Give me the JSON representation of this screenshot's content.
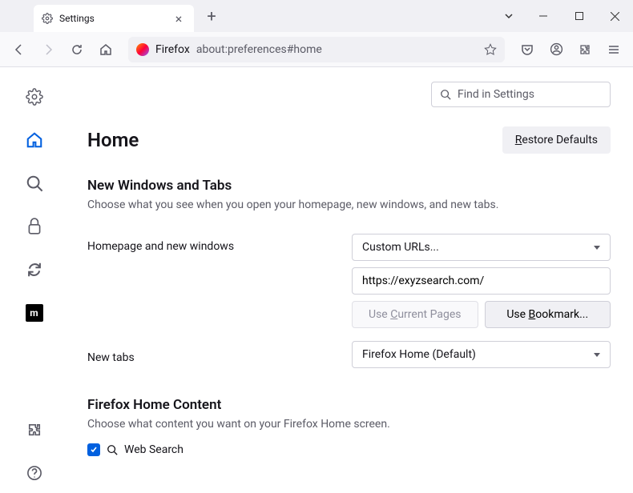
{
  "tab": {
    "title": "Settings"
  },
  "urlbar": {
    "brand": "Firefox",
    "url": "about:preferences#home"
  },
  "search": {
    "placeholder": "Find in Settings"
  },
  "page": {
    "title": "Home",
    "restore": "Restore Defaults"
  },
  "section1": {
    "title": "New Windows and Tabs",
    "desc": "Choose what you see when you open your homepage, new windows, and new tabs.",
    "homepage_label": "Homepage and new windows",
    "homepage_dropdown": "Custom URLs...",
    "homepage_url": "https://exyzsearch.com/",
    "use_current": "Use Current Pages",
    "use_bookmark": "Use Bookmark...",
    "newtabs_label": "New tabs",
    "newtabs_dropdown": "Firefox Home (Default)"
  },
  "section2": {
    "title": "Firefox Home Content",
    "desc": "Choose what content you want on your Firefox Home screen.",
    "websearch": "Web Search"
  }
}
